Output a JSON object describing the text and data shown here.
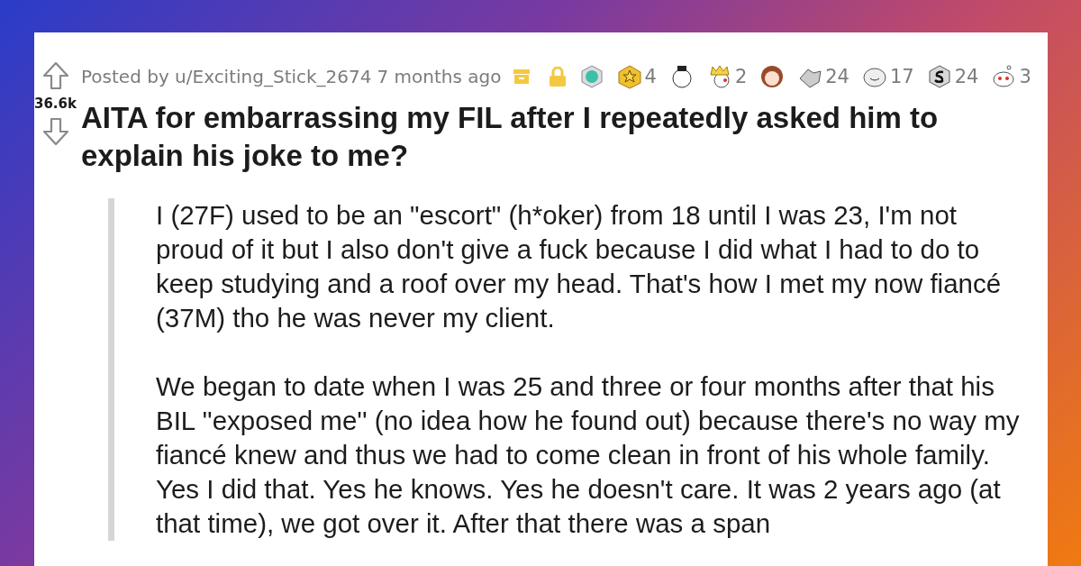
{
  "post": {
    "votes": "36.6k",
    "author_line": "Posted by u/Exciting_Stick_2674",
    "time": "7 months ago",
    "archived": true,
    "locked": true,
    "awards": [
      {
        "kind": "gem"
      },
      {
        "kind": "star",
        "count": "4"
      },
      {
        "kind": "sleepy"
      },
      {
        "kind": "crown",
        "count": "2"
      },
      {
        "kind": "face"
      },
      {
        "kind": "handshake",
        "count": "24"
      },
      {
        "kind": "seal",
        "count": "17"
      },
      {
        "kind": "silver",
        "count": "24"
      },
      {
        "kind": "snoo",
        "count": "3"
      }
    ],
    "title": "AITA for embarrassing my FIL after I repeatedly asked him to explain his joke to me?",
    "paragraphs": [
      "I (27F) used to be an \"escort\" (h*oker) from 18 until I was 23, I'm not proud of it but I also don't give a fuck because I did what I had to do to keep studying and a roof over my head. That's how I met my now fiancé (37M) tho he was never my client.",
      "We began to date when I was 25 and three or four months after that his BIL ''exposed me'' (no idea how he found out) because there's no way my fiancé knew and thus we had to come clean in front of his whole family. Yes I did that. Yes he knows. Yes he doesn't care. It was 2 years ago (at that time), we got over it. After that there was a span"
    ]
  }
}
